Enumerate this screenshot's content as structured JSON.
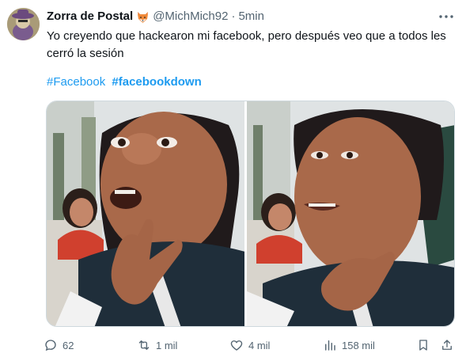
{
  "tweet": {
    "display_name": "Zorra de Postal",
    "name_emoji": "fox-emoji",
    "handle": "@MichMich92",
    "separator": "·",
    "time": "5min",
    "text": "Yo creyendo que hackearon mi facebook, pero después veo que a todos les cerró la sesión",
    "hashtags": [
      "#Facebook",
      "#facebookdown"
    ]
  },
  "actions": {
    "replies": "62",
    "retweets": "1 mil",
    "likes": "4 mil",
    "views": "158 mil"
  },
  "icons": {
    "more": "more-horizontal-icon",
    "reply": "reply-icon",
    "retweet": "retweet-icon",
    "like": "heart-icon",
    "views": "views-icon",
    "bookmark": "bookmark-icon",
    "share": "share-icon"
  },
  "colors": {
    "accent": "#1d9bf0",
    "muted": "#536471",
    "text": "#0f1419"
  }
}
